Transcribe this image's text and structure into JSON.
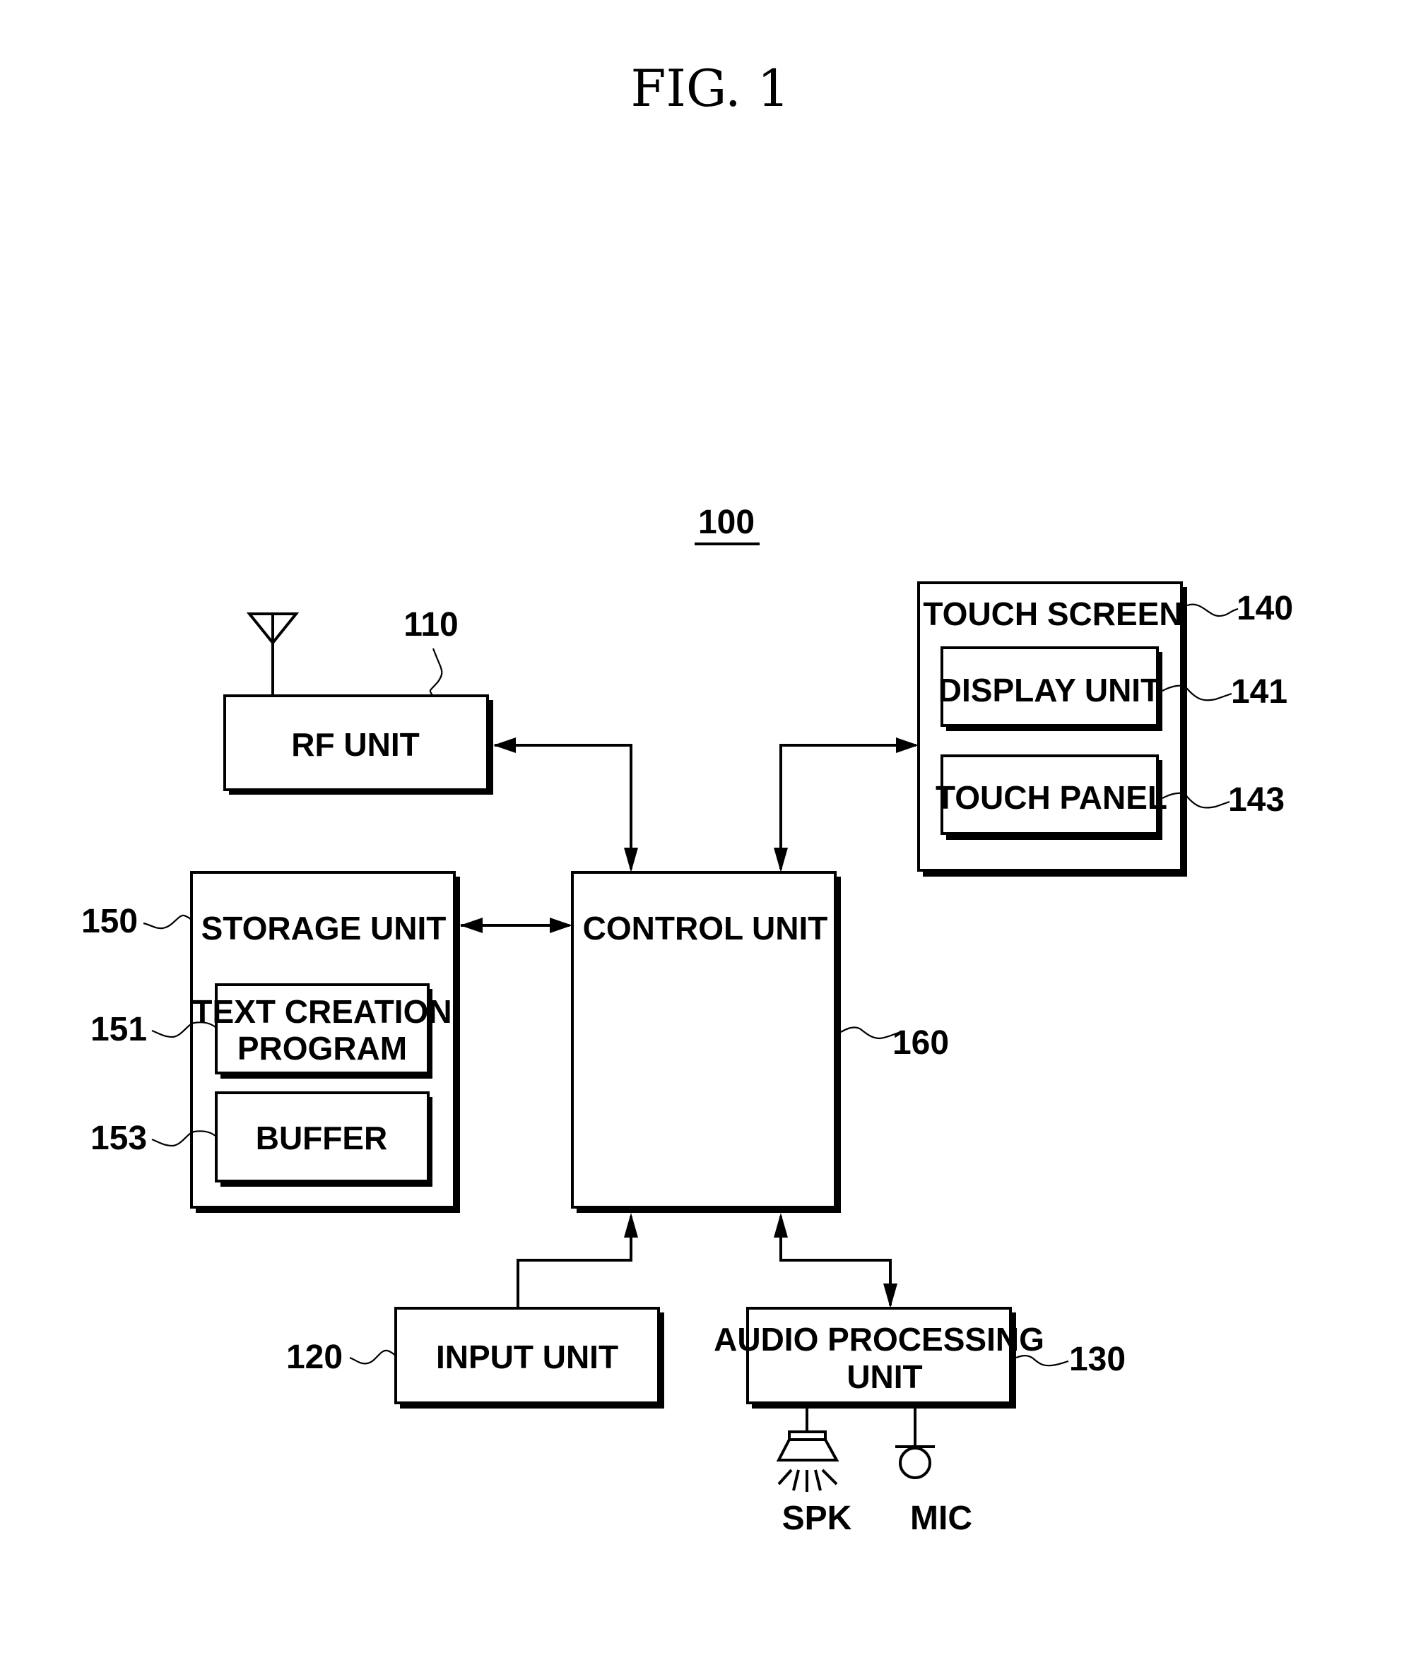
{
  "figure": {
    "title": "FIG. 1",
    "device_ref": "100"
  },
  "blocks": {
    "rf_unit": {
      "label": "RF UNIT",
      "ref": "110"
    },
    "input_unit": {
      "label": "INPUT UNIT",
      "ref": "120"
    },
    "audio_processing_unit": {
      "label_line1": "AUDIO PROCESSING",
      "label_line2": "UNIT",
      "ref": "130"
    },
    "touch_screen": {
      "label": "TOUCH SCREEN",
      "ref": "140"
    },
    "display_unit": {
      "label": "DISPLAY UNIT",
      "ref": "141"
    },
    "touch_panel": {
      "label": "TOUCH PANEL",
      "ref": "143"
    },
    "storage_unit": {
      "label": "STORAGE UNIT",
      "ref": "150"
    },
    "text_creation_program": {
      "label_line1": "TEXT CREATION",
      "label_line2": "PROGRAM",
      "ref": "151"
    },
    "buffer": {
      "label": "BUFFER",
      "ref": "153"
    },
    "control_unit": {
      "label": "CONTROL UNIT",
      "ref": "160"
    }
  },
  "peripherals": {
    "speaker": {
      "label": "SPK",
      "icon": "speaker-icon"
    },
    "microphone": {
      "label": "MIC",
      "icon": "microphone-icon"
    },
    "antenna": {
      "icon": "antenna-icon"
    }
  },
  "connections": [
    {
      "from": "rf_unit",
      "to": "control_unit",
      "direction": "bidirectional"
    },
    {
      "from": "touch_screen",
      "to": "control_unit",
      "direction": "bidirectional"
    },
    {
      "from": "storage_unit",
      "to": "control_unit",
      "direction": "bidirectional"
    },
    {
      "from": "input_unit",
      "to": "control_unit",
      "direction": "unidirectional"
    },
    {
      "from": "audio_processing_unit",
      "to": "control_unit",
      "direction": "bidirectional"
    }
  ]
}
